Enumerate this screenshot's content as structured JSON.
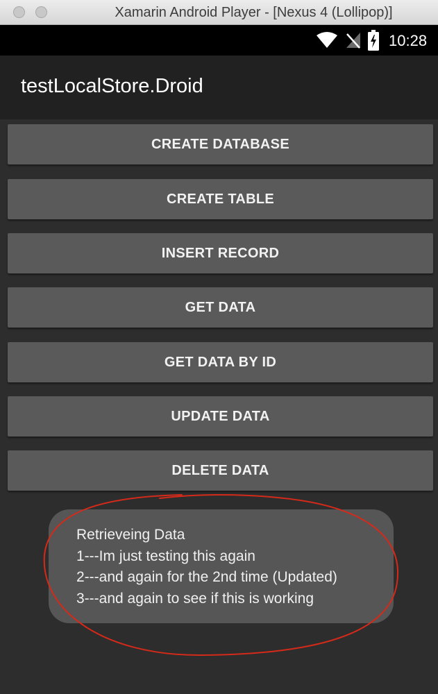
{
  "window": {
    "title": "Xamarin Android Player - [Nexus 4 (Lollipop)]"
  },
  "statusbar": {
    "time": "10:28",
    "icons": [
      "wifi-icon",
      "no-sim-signal-icon",
      "battery-charging-icon"
    ]
  },
  "app": {
    "title": "testLocalStore.Droid"
  },
  "buttons": [
    {
      "label": "CREATE DATABASE"
    },
    {
      "label": "CREATE TABLE"
    },
    {
      "label": "INSERT RECORD"
    },
    {
      "label": "GET DATA"
    },
    {
      "label": "GET DATA BY ID"
    },
    {
      "label": "UPDATE DATA"
    },
    {
      "label": "DELETE DATA"
    }
  ],
  "toast": {
    "lines": [
      "Retrieveing Data",
      "1---Im just testing this again",
      "2---and again for the 2nd time (Updated)",
      "3---and again to see if this is working"
    ]
  },
  "colors": {
    "button_bg": "#5a5a5a",
    "actionbar_bg": "#212121",
    "annotation_stroke": "#d42a1a"
  }
}
